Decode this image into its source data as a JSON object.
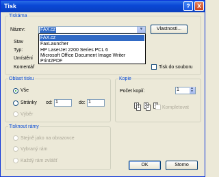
{
  "window": {
    "title": "Tisk",
    "help_button": "?",
    "close_button": "X"
  },
  "printer_group": {
    "legend": "Tiskárna",
    "name_label": "Název:",
    "name_value": "FAX.cz",
    "properties_button": "Vlastnosti...",
    "status_label": "Stav",
    "type_label": "Typ:",
    "location_label": "Umístění",
    "comment_label": "Komentář",
    "print_to_file": "Tisk do souboru",
    "printers": [
      "FAX.cz",
      "FaxLauncher",
      "HP LaserJet 2200 Series PCL 6",
      "Microsoft Office Document Image Writer",
      "Print2PDF"
    ],
    "selected_printer": 0
  },
  "range_group": {
    "legend": "Oblast tisku",
    "all": "Vše",
    "pages": "Stránky",
    "from_label": "od:",
    "from_value": "1",
    "to_label": "do:",
    "to_value": "1",
    "selection": "Výběr"
  },
  "copies_group": {
    "legend": "Kopie",
    "copies_label": "Počet kopií:",
    "copies_value": "1",
    "collate": "Kompletovat",
    "page_numbers": [
      "1",
      "1",
      "2",
      "2",
      "3"
    ]
  },
  "frames_group": {
    "legend": "Tisknout rámy",
    "options": [
      "Stejně jako na obrazovce",
      "Vybraný rám",
      "Každý rám zvlášť"
    ]
  },
  "buttons": {
    "ok": "OK",
    "cancel": "Storno"
  }
}
